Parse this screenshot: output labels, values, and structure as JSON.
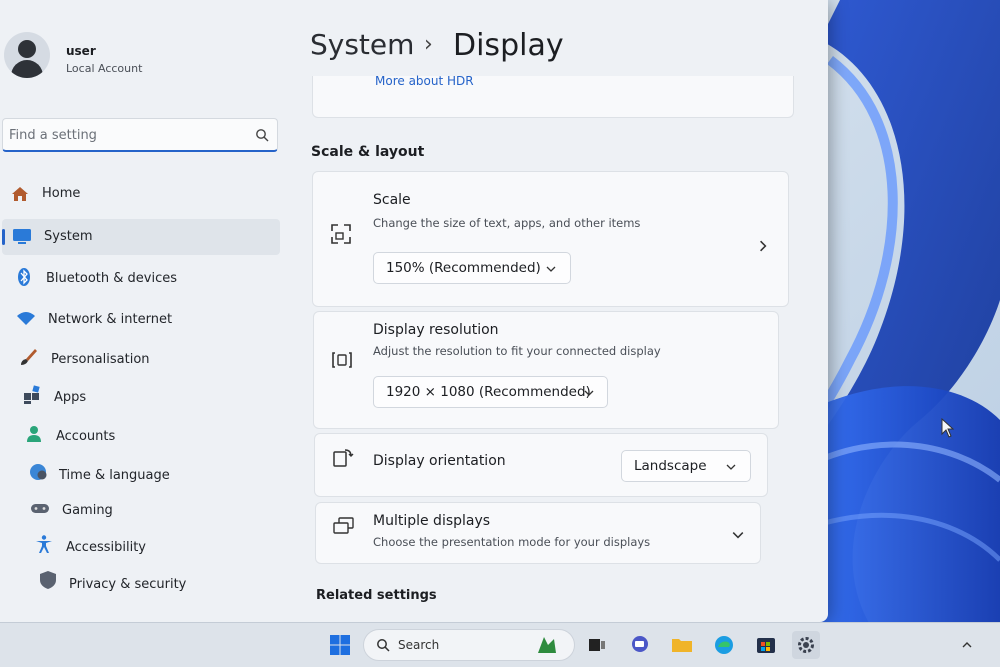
{
  "colors": {
    "accent": "#2563c9",
    "window_bg": "#eef1f5",
    "card_bg": "#f8f9fb"
  },
  "user": {
    "name": "user",
    "account_type": "Local Account"
  },
  "search": {
    "placeholder": "Find a setting"
  },
  "sidebar": {
    "items": [
      {
        "label": "Home",
        "icon": "home-icon"
      },
      {
        "label": "System",
        "icon": "system-icon",
        "active": true
      },
      {
        "label": "Bluetooth & devices",
        "icon": "bluetooth-icon"
      },
      {
        "label": "Network & internet",
        "icon": "wifi-icon"
      },
      {
        "label": "Personalisation",
        "icon": "brush-icon"
      },
      {
        "label": "Apps",
        "icon": "apps-icon"
      },
      {
        "label": "Accounts",
        "icon": "accounts-icon"
      },
      {
        "label": "Time & language",
        "icon": "globe-icon"
      },
      {
        "label": "Gaming",
        "icon": "gamepad-icon"
      },
      {
        "label": "Accessibility",
        "icon": "accessibility-icon"
      },
      {
        "label": "Privacy & security",
        "icon": "shield-icon"
      }
    ]
  },
  "breadcrumb": {
    "root": "System",
    "separator": "›",
    "page": "Display"
  },
  "hdr": {
    "link": "More about HDR"
  },
  "section": {
    "title": "Scale & layout"
  },
  "cards": {
    "scale": {
      "title": "Scale",
      "description": "Change the size of text, apps, and other items",
      "value": "150% (Recommended)"
    },
    "resolution": {
      "title": "Display resolution",
      "description": "Adjust the resolution to fit your connected display",
      "value": "1920 × 1080 (Recommended)"
    },
    "orientation": {
      "title": "Display orientation",
      "value": "Landscape"
    },
    "multiple": {
      "title": "Multiple displays",
      "description": "Choose the presentation mode for your displays"
    }
  },
  "related": {
    "title": "Related settings"
  },
  "taskbar": {
    "search_label": "Search"
  }
}
